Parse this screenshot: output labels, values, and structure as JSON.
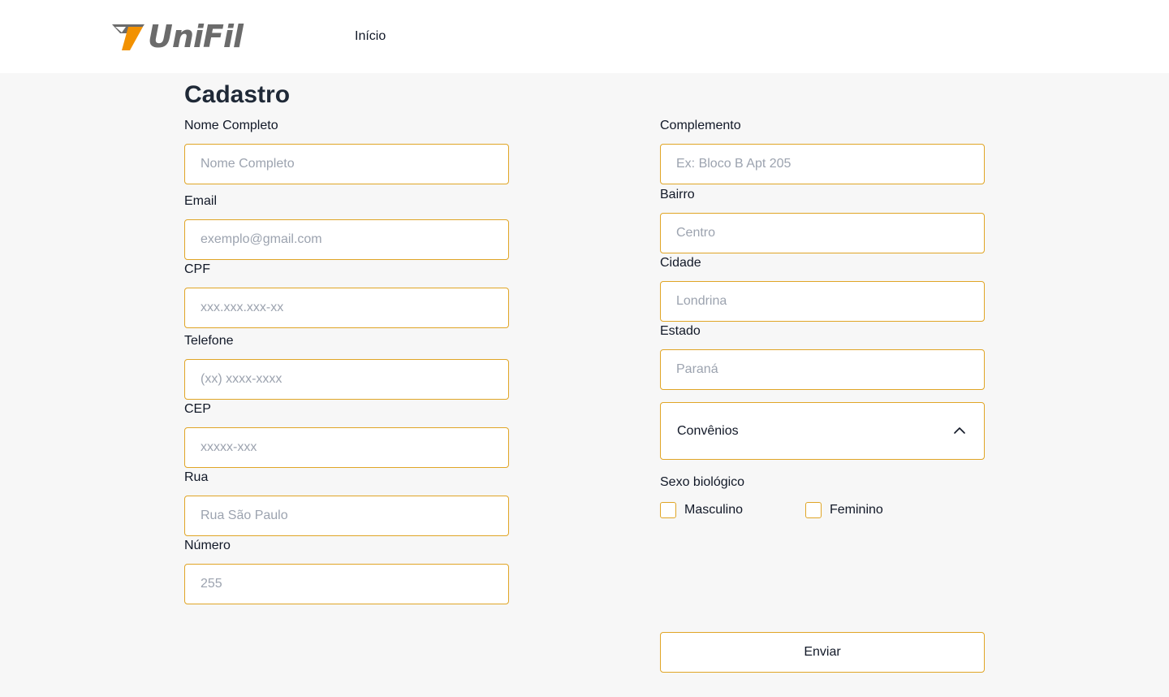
{
  "header": {
    "logo_text": "UniFil",
    "nav": {
      "home_label": "Início"
    }
  },
  "colors": {
    "accent_orange": "#f29100",
    "border_gold": "#e0a526",
    "logo_gray": "#6b6b6b",
    "page_background": "#f7f7f7"
  },
  "form": {
    "title": "Cadastro",
    "left_fields": [
      {
        "label": "Nome Completo",
        "placeholder": "Nome Completo",
        "value": ""
      },
      {
        "label": "Email",
        "placeholder": "exemplo@gmail.com",
        "value": ""
      },
      {
        "label": "CPF",
        "placeholder": "xxx.xxx.xxx-xx",
        "value": ""
      },
      {
        "label": "Telefone",
        "placeholder": "(xx) xxxx-xxxx",
        "value": ""
      },
      {
        "label": "CEP",
        "placeholder": "xxxxx-xxx",
        "value": ""
      },
      {
        "label": "Rua",
        "placeholder": "Rua São Paulo",
        "value": ""
      },
      {
        "label": "Número",
        "placeholder": "255",
        "value": ""
      }
    ],
    "right_fields": [
      {
        "label": "Complemento",
        "placeholder": "Ex: Bloco B Apt 205",
        "value": ""
      },
      {
        "label": "Bairro",
        "placeholder": "Centro",
        "value": ""
      },
      {
        "label": "Cidade",
        "placeholder": "Londrina",
        "value": ""
      },
      {
        "label": "Estado",
        "placeholder": "Paraná",
        "value": ""
      }
    ],
    "convenios": {
      "label": "Convênios",
      "icon": "chevron-up-icon",
      "expanded": true
    },
    "sex": {
      "label": "Sexo biológico",
      "options": [
        {
          "label": "Masculino",
          "checked": false
        },
        {
          "label": "Feminino",
          "checked": false
        }
      ]
    },
    "submit_label": "Enviar"
  }
}
